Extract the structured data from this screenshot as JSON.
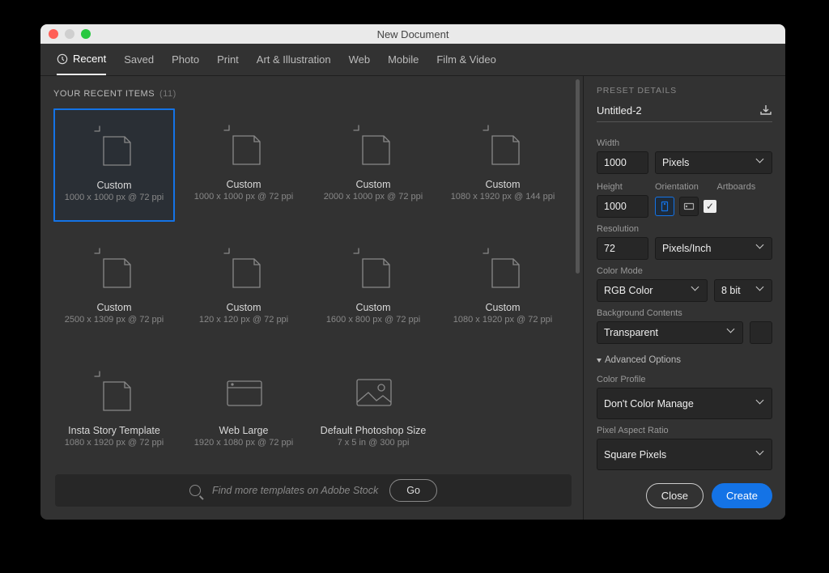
{
  "window": {
    "title": "New Document"
  },
  "tabs": [
    "Recent",
    "Saved",
    "Photo",
    "Print",
    "Art & Illustration",
    "Web",
    "Mobile",
    "Film & Video"
  ],
  "section": {
    "label": "YOUR RECENT ITEMS",
    "count": "(11)"
  },
  "presets": [
    {
      "name": "Custom",
      "dim": "1000 x 1000 px @ 72 ppi",
      "icon": "doc",
      "selected": true
    },
    {
      "name": "Custom",
      "dim": "1000 x 1000 px @ 72 ppi",
      "icon": "doc"
    },
    {
      "name": "Custom",
      "dim": "2000 x 1000 px @ 72 ppi",
      "icon": "doc"
    },
    {
      "name": "Custom",
      "dim": "1080 x 1920 px @ 144 ppi",
      "icon": "doc"
    },
    {
      "name": "Custom",
      "dim": "2500 x 1309 px @ 72 ppi",
      "icon": "doc"
    },
    {
      "name": "Custom",
      "dim": "120 x 120 px @ 72 ppi",
      "icon": "doc"
    },
    {
      "name": "Custom",
      "dim": "1600 x 800 px @ 72 ppi",
      "icon": "doc"
    },
    {
      "name": "Custom",
      "dim": "1080 x 1920 px @ 72 ppi",
      "icon": "doc"
    },
    {
      "name": "Insta Story Template",
      "dim": "1080 x 1920 px @ 72 ppi",
      "icon": "doc"
    },
    {
      "name": "Web Large",
      "dim": "1920 x 1080 px @ 72 ppi",
      "icon": "web"
    },
    {
      "name": "Default Photoshop Size",
      "dim": "7 x 5 in @ 300 ppi",
      "icon": "image"
    }
  ],
  "stock": {
    "placeholder": "Find more templates on Adobe Stock",
    "go": "Go"
  },
  "details": {
    "heading": "PRESET DETAILS",
    "name": "Untitled-2",
    "width_label": "Width",
    "width": "1000",
    "width_unit": "Pixels",
    "height_label": "Height",
    "height": "1000",
    "orientation_label": "Orientation",
    "artboards_label": "Artboards",
    "artboards_checked": true,
    "resolution_label": "Resolution",
    "resolution": "72",
    "resolution_unit": "Pixels/Inch",
    "color_mode_label": "Color Mode",
    "color_mode": "RGB Color",
    "color_depth": "8 bit",
    "bg_label": "Background Contents",
    "bg": "Transparent",
    "advanced": "Advanced Options",
    "color_profile_label": "Color Profile",
    "color_profile": "Don't Color Manage",
    "par_label": "Pixel Aspect Ratio",
    "par": "Square Pixels"
  },
  "buttons": {
    "close": "Close",
    "create": "Create"
  }
}
